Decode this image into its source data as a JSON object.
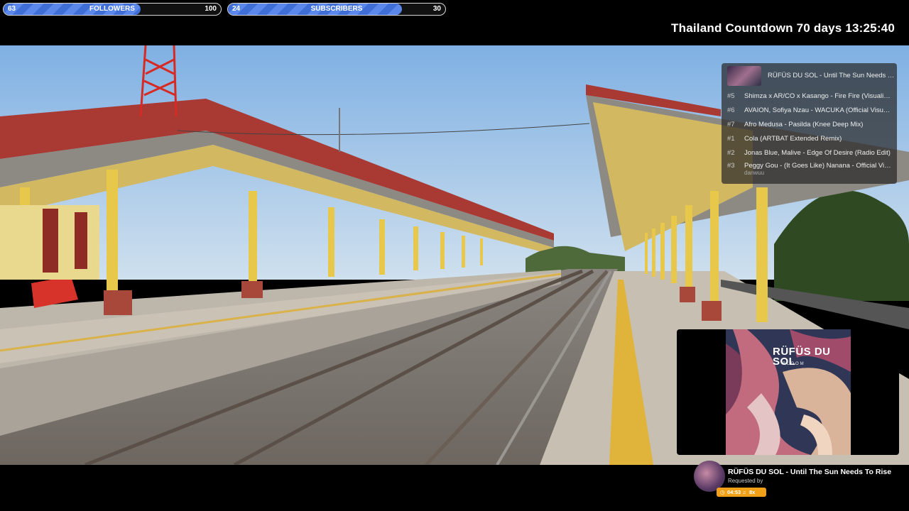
{
  "goals": {
    "followers": {
      "current": "63",
      "label": "FOLLOWERS",
      "target": "100",
      "progress": 0.63
    },
    "subscribers": {
      "current": "24",
      "label": "SUBSCRIBERS",
      "target": "30",
      "progress": 0.8
    }
  },
  "countdown": {
    "text": "Thailand Countdown 70 days 13:25:40"
  },
  "playlist": {
    "now_playing": "RÜFÜS DU SOL - Until The Sun Needs To Rise",
    "items": [
      {
        "num": "#5",
        "title": "Shimza x AR/CO x Kasango - Fire Fire (Visualizer)"
      },
      {
        "num": "#6",
        "title": "AVAION, Sofiya Nzau - WACUKA (Official Visualizer)"
      },
      {
        "num": "#7",
        "title": "Afro Medusa - Pasilda (Knee Deep Mix)"
      },
      {
        "num": "#1",
        "title": "Cola (ARTBAT Extended Remix)"
      },
      {
        "num": "#2",
        "title": "Jonas Blue, Malive - Edge Of Desire (Radio Edit)"
      },
      {
        "num": "#3",
        "title": "Peggy Gou - (It Goes Like) Nanana - Official Video"
      }
    ],
    "requested_user": "danwuu"
  },
  "album": {
    "artist": "RÜFÜS DU SOL",
    "album": "BLOOM"
  },
  "now_playing": {
    "title": "RÜFÜS DU SOL - Until The Sun Needs To Rise",
    "requested_by": "Requested by",
    "time": "04:53",
    "volume": "8x"
  },
  "colors": {
    "goal_fill": "#4a7be0",
    "badge": "#f1a017",
    "roof": "#a83a33",
    "pillar": "#e8c84a"
  }
}
